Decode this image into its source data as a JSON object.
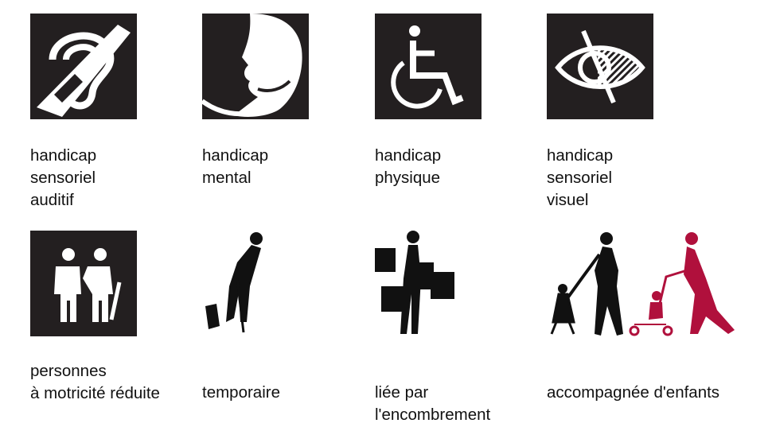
{
  "colors": {
    "pictogram_bg": "#231f20",
    "accent": "#b0103c",
    "text": "#111111"
  },
  "items": [
    {
      "icon": "hearing-impairment-icon",
      "lines": [
        "handicap",
        "sensoriel",
        "auditif"
      ]
    },
    {
      "icon": "mental-disability-icon",
      "lines": [
        "handicap",
        "mental"
      ]
    },
    {
      "icon": "wheelchair-icon",
      "lines": [
        "handicap",
        "physique"
      ]
    },
    {
      "icon": "visual-impairment-icon",
      "lines": [
        "handicap",
        "sensoriel",
        "visuel"
      ]
    },
    {
      "icon": "elderly-people-icon",
      "lines": [
        "personnes",
        "à motricité réduite"
      ]
    },
    {
      "icon": "person-with-cane-icon",
      "lines": [
        "temporaire"
      ]
    },
    {
      "icon": "person-with-shopping-bags-icon",
      "lines": [
        "liée par",
        "l'encombrement"
      ]
    },
    {
      "icon": "parents-with-children-icon",
      "lines": [
        "accompagnée d'enfants"
      ]
    }
  ]
}
